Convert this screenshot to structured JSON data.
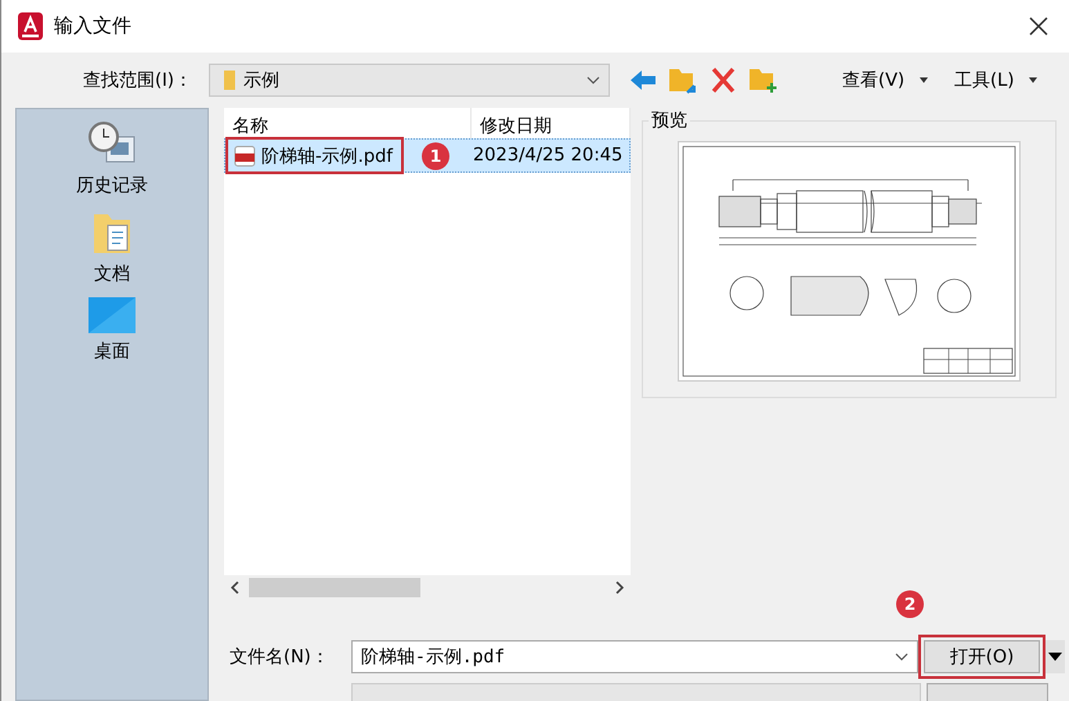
{
  "window": {
    "title": "输入文件"
  },
  "toolbar": {
    "look_in_label": "查找范围(I)：",
    "look_in_value": "示例",
    "view_menu": "查看(V)",
    "tools_menu": "工具(L)"
  },
  "places": [
    {
      "label": "历史记录",
      "kind": "history"
    },
    {
      "label": "文档",
      "kind": "documents"
    },
    {
      "label": "桌面",
      "kind": "desktop"
    }
  ],
  "file_list": {
    "columns": [
      "名称",
      "修改日期"
    ],
    "rows": [
      {
        "name": "阶梯轴-示例.pdf",
        "modified": "2023/4/25 20:45",
        "selected": true
      }
    ]
  },
  "preview": {
    "title": "预览"
  },
  "file_name": {
    "label": "文件名(N)：",
    "value": "阶梯轴-示例.pdf"
  },
  "open_button": "打开(O)",
  "annotations": [
    {
      "number": "1",
      "kind": "file-row"
    },
    {
      "number": "2",
      "kind": "open-button"
    }
  ]
}
